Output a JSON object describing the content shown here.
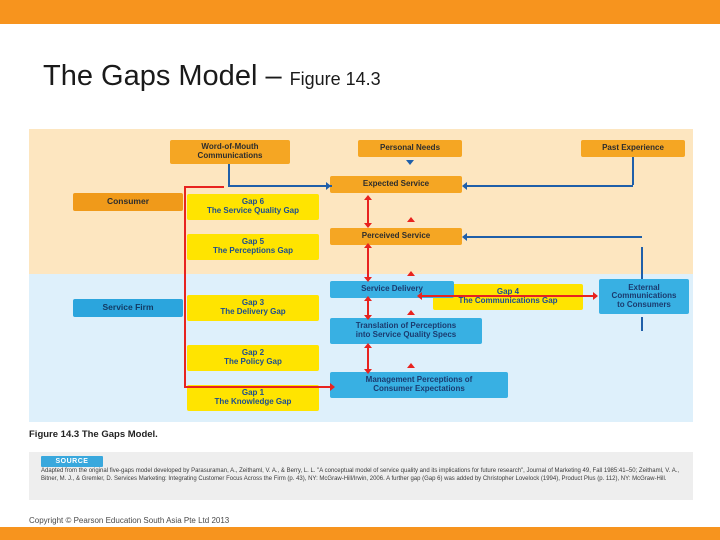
{
  "slide": {
    "title_main": "The Gaps Model – ",
    "title_sub": "Figure 14.3",
    "copyright": "Copyright © Pearson Education South Asia Pte Ltd 2013",
    "figure_caption_number": "Figure 14.3",
    "figure_caption_text": "The Gaps Model.",
    "source_tab_label": "SOURCE",
    "source_text": "Adapted from the original five-gaps model developed by Parasuraman, A., Zeithaml, V. A., & Berry, L. L. \"A conceptual model of service quality and its implications for future research\", Journal of Marketing 49, Fall 1985:41–50; Zeithaml, V. A., Bitner, M. J., & Gremler, D. Services Marketing: Integrating Customer Focus Across the Firm (p. 43), NY: McGraw-Hill/Irwin, 2006. A further gap (Gap 6) was added by Christopher Lovelock (1994), Product Plus (p. 112), NY: McGraw-Hill."
  },
  "diagram": {
    "bands": [
      {
        "key": "consumer",
        "label": "Consumer"
      },
      {
        "key": "firm",
        "label": "Service Firm"
      }
    ],
    "nodes": {
      "word_of_mouth": "Word-of-Mouth\nCommunications",
      "personal_needs": "Personal Needs",
      "past_experience": "Past Experience",
      "expected_service": "Expected Service",
      "perceived_service": "Perceived Service",
      "service_delivery": "Service Delivery",
      "translation": "Translation of Perceptions\ninto Service Quality Specs",
      "mgmt_perceptions": "Management Perceptions of\nConsumer Expectations",
      "external_comm": "External\nCommunications\nto Consumers"
    },
    "gaps": [
      {
        "id": "gap6",
        "number": "Gap 6",
        "name": "The Service Quality Gap"
      },
      {
        "id": "gap5",
        "number": "Gap 5",
        "name": "The Perceptions Gap"
      },
      {
        "id": "gap3",
        "number": "Gap 3",
        "name": "The Delivery Gap"
      },
      {
        "id": "gap4",
        "number": "Gap 4",
        "name": "The Communications Gap"
      },
      {
        "id": "gap2",
        "number": "Gap 2",
        "name": "The Policy Gap"
      },
      {
        "id": "gap1",
        "number": "Gap 1",
        "name": "The Knowledge Gap"
      }
    ],
    "colors": {
      "accent_bar": "#f7941e",
      "consumer_band": "#fde6c0",
      "firm_band": "#def0fb",
      "orange_node": "#f5a623",
      "yellow_gap": "#ffe400",
      "blue_node": "#38b0e3",
      "red_arrow": "#e8231f",
      "blue_arrow": "#1f5fa9"
    }
  }
}
